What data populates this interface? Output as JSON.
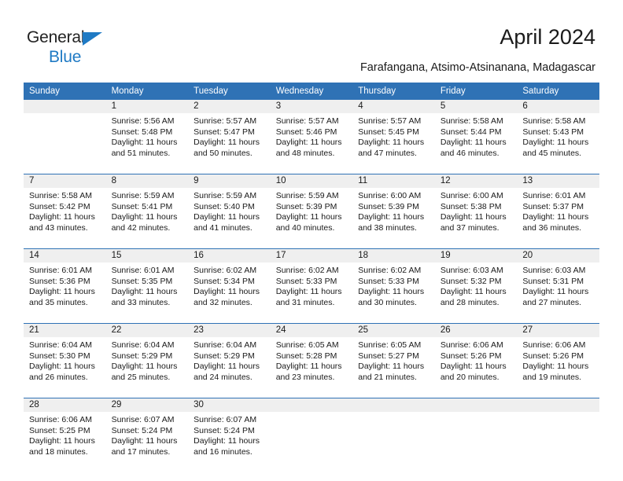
{
  "brand": {
    "name_top": "General",
    "name_bottom": "Blue",
    "triangle_icon": "blue-triangle-logo-mark",
    "accent_color": "#1f7ac4"
  },
  "header": {
    "title": "April 2024",
    "subtitle": "Farafangana, Atsimo-Atsinanana, Madagascar"
  },
  "colors": {
    "header_blue": "#2f72b5",
    "daynum_band": "#efefef",
    "text": "#1a1a1a"
  },
  "calendar": {
    "weekday_headers": [
      "Sunday",
      "Monday",
      "Tuesday",
      "Wednesday",
      "Thursday",
      "Friday",
      "Saturday"
    ],
    "weeks": [
      [
        {
          "day": "",
          "lines": []
        },
        {
          "day": "1",
          "lines": [
            "Sunrise: 5:56 AM",
            "Sunset: 5:48 PM",
            "Daylight: 11 hours",
            "and 51 minutes."
          ]
        },
        {
          "day": "2",
          "lines": [
            "Sunrise: 5:57 AM",
            "Sunset: 5:47 PM",
            "Daylight: 11 hours",
            "and 50 minutes."
          ]
        },
        {
          "day": "3",
          "lines": [
            "Sunrise: 5:57 AM",
            "Sunset: 5:46 PM",
            "Daylight: 11 hours",
            "and 48 minutes."
          ]
        },
        {
          "day": "4",
          "lines": [
            "Sunrise: 5:57 AM",
            "Sunset: 5:45 PM",
            "Daylight: 11 hours",
            "and 47 minutes."
          ]
        },
        {
          "day": "5",
          "lines": [
            "Sunrise: 5:58 AM",
            "Sunset: 5:44 PM",
            "Daylight: 11 hours",
            "and 46 minutes."
          ]
        },
        {
          "day": "6",
          "lines": [
            "Sunrise: 5:58 AM",
            "Sunset: 5:43 PM",
            "Daylight: 11 hours",
            "and 45 minutes."
          ]
        }
      ],
      [
        {
          "day": "7",
          "lines": [
            "Sunrise: 5:58 AM",
            "Sunset: 5:42 PM",
            "Daylight: 11 hours",
            "and 43 minutes."
          ]
        },
        {
          "day": "8",
          "lines": [
            "Sunrise: 5:59 AM",
            "Sunset: 5:41 PM",
            "Daylight: 11 hours",
            "and 42 minutes."
          ]
        },
        {
          "day": "9",
          "lines": [
            "Sunrise: 5:59 AM",
            "Sunset: 5:40 PM",
            "Daylight: 11 hours",
            "and 41 minutes."
          ]
        },
        {
          "day": "10",
          "lines": [
            "Sunrise: 5:59 AM",
            "Sunset: 5:39 PM",
            "Daylight: 11 hours",
            "and 40 minutes."
          ]
        },
        {
          "day": "11",
          "lines": [
            "Sunrise: 6:00 AM",
            "Sunset: 5:39 PM",
            "Daylight: 11 hours",
            "and 38 minutes."
          ]
        },
        {
          "day": "12",
          "lines": [
            "Sunrise: 6:00 AM",
            "Sunset: 5:38 PM",
            "Daylight: 11 hours",
            "and 37 minutes."
          ]
        },
        {
          "day": "13",
          "lines": [
            "Sunrise: 6:01 AM",
            "Sunset: 5:37 PM",
            "Daylight: 11 hours",
            "and 36 minutes."
          ]
        }
      ],
      [
        {
          "day": "14",
          "lines": [
            "Sunrise: 6:01 AM",
            "Sunset: 5:36 PM",
            "Daylight: 11 hours",
            "and 35 minutes."
          ]
        },
        {
          "day": "15",
          "lines": [
            "Sunrise: 6:01 AM",
            "Sunset: 5:35 PM",
            "Daylight: 11 hours",
            "and 33 minutes."
          ]
        },
        {
          "day": "16",
          "lines": [
            "Sunrise: 6:02 AM",
            "Sunset: 5:34 PM",
            "Daylight: 11 hours",
            "and 32 minutes."
          ]
        },
        {
          "day": "17",
          "lines": [
            "Sunrise: 6:02 AM",
            "Sunset: 5:33 PM",
            "Daylight: 11 hours",
            "and 31 minutes."
          ]
        },
        {
          "day": "18",
          "lines": [
            "Sunrise: 6:02 AM",
            "Sunset: 5:33 PM",
            "Daylight: 11 hours",
            "and 30 minutes."
          ]
        },
        {
          "day": "19",
          "lines": [
            "Sunrise: 6:03 AM",
            "Sunset: 5:32 PM",
            "Daylight: 11 hours",
            "and 28 minutes."
          ]
        },
        {
          "day": "20",
          "lines": [
            "Sunrise: 6:03 AM",
            "Sunset: 5:31 PM",
            "Daylight: 11 hours",
            "and 27 minutes."
          ]
        }
      ],
      [
        {
          "day": "21",
          "lines": [
            "Sunrise: 6:04 AM",
            "Sunset: 5:30 PM",
            "Daylight: 11 hours",
            "and 26 minutes."
          ]
        },
        {
          "day": "22",
          "lines": [
            "Sunrise: 6:04 AM",
            "Sunset: 5:29 PM",
            "Daylight: 11 hours",
            "and 25 minutes."
          ]
        },
        {
          "day": "23",
          "lines": [
            "Sunrise: 6:04 AM",
            "Sunset: 5:29 PM",
            "Daylight: 11 hours",
            "and 24 minutes."
          ]
        },
        {
          "day": "24",
          "lines": [
            "Sunrise: 6:05 AM",
            "Sunset: 5:28 PM",
            "Daylight: 11 hours",
            "and 23 minutes."
          ]
        },
        {
          "day": "25",
          "lines": [
            "Sunrise: 6:05 AM",
            "Sunset: 5:27 PM",
            "Daylight: 11 hours",
            "and 21 minutes."
          ]
        },
        {
          "day": "26",
          "lines": [
            "Sunrise: 6:06 AM",
            "Sunset: 5:26 PM",
            "Daylight: 11 hours",
            "and 20 minutes."
          ]
        },
        {
          "day": "27",
          "lines": [
            "Sunrise: 6:06 AM",
            "Sunset: 5:26 PM",
            "Daylight: 11 hours",
            "and 19 minutes."
          ]
        }
      ],
      [
        {
          "day": "28",
          "lines": [
            "Sunrise: 6:06 AM",
            "Sunset: 5:25 PM",
            "Daylight: 11 hours",
            "and 18 minutes."
          ]
        },
        {
          "day": "29",
          "lines": [
            "Sunrise: 6:07 AM",
            "Sunset: 5:24 PM",
            "Daylight: 11 hours",
            "and 17 minutes."
          ]
        },
        {
          "day": "30",
          "lines": [
            "Sunrise: 6:07 AM",
            "Sunset: 5:24 PM",
            "Daylight: 11 hours",
            "and 16 minutes."
          ]
        },
        {
          "day": "",
          "lines": []
        },
        {
          "day": "",
          "lines": []
        },
        {
          "day": "",
          "lines": []
        },
        {
          "day": "",
          "lines": []
        }
      ]
    ]
  }
}
